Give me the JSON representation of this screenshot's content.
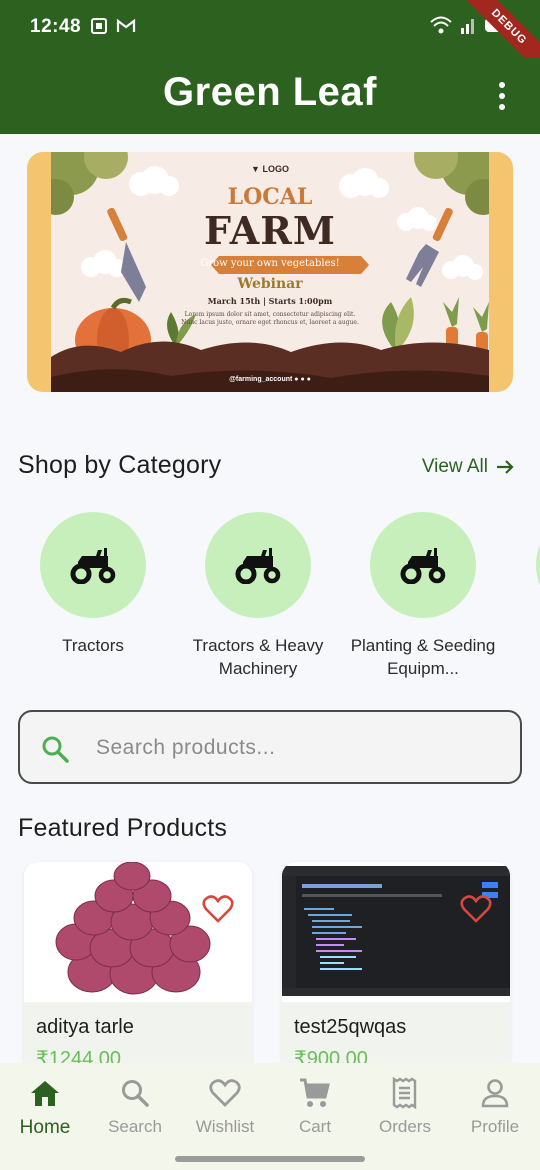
{
  "status_bar": {
    "time": "12:48",
    "ribbon": "DEBUG"
  },
  "app_bar": {
    "title": "Green Leaf"
  },
  "banner": {
    "logo": "LOGO",
    "headline_1": "LOCAL",
    "headline_2": "FARM",
    "tagline": "Grow your own vegetables!",
    "event": "Webinar",
    "date": "March 15th | Starts 1:00pm",
    "body_1": "Lorem ipsum dolor sit amet, consectetur adipiscing elit.",
    "body_2": "Nunc lacus justo, ornare eget rhoncus et, laoreet a augue.",
    "handle": "@farming_account"
  },
  "categories": {
    "title": "Shop by Category",
    "view_all": "View All",
    "items": [
      {
        "label": "Tractors"
      },
      {
        "label": "Tractors & Heavy Machinery"
      },
      {
        "label": "Planting & Seeding Equipm..."
      }
    ]
  },
  "search": {
    "placeholder": "Search products..."
  },
  "featured": {
    "title": "Featured Products",
    "products": [
      {
        "name": "aditya tarle",
        "price": "₹1244.00"
      },
      {
        "name": "test25qwqas",
        "price": "₹900.00"
      }
    ]
  },
  "bottom_nav": {
    "items": [
      {
        "label": "Home",
        "icon": "home-icon"
      },
      {
        "label": "Search",
        "icon": "search-icon"
      },
      {
        "label": "Wishlist",
        "icon": "heart-icon"
      },
      {
        "label": "Cart",
        "icon": "cart-icon"
      },
      {
        "label": "Orders",
        "icon": "receipt-icon"
      },
      {
        "label": "Profile",
        "icon": "person-icon"
      }
    ]
  },
  "colors": {
    "primary": "#2d6120",
    "category_bg": "#c7efbb",
    "price": "#6abf58",
    "heart": "#d9463b"
  }
}
